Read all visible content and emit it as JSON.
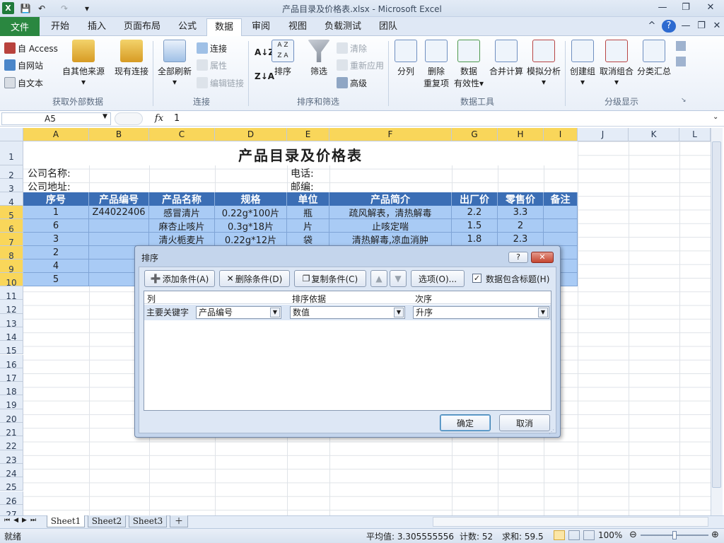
{
  "window": {
    "title": "产品目录及价格表.xlsx - Microsoft Excel",
    "app_letter": "X",
    "controls": {
      "minimize": "—",
      "restore": "❐",
      "close": "✕"
    },
    "ribbon_controls": {
      "collapse": "^",
      "help": "?",
      "minimize": "—",
      "restore": "❐",
      "close": "✕"
    }
  },
  "tabs": {
    "file": "文件",
    "items": [
      "开始",
      "插入",
      "页面布局",
      "公式",
      "数据",
      "审阅",
      "视图",
      "负载测试",
      "团队"
    ],
    "active": "数据"
  },
  "ribbon": {
    "get_external": {
      "label": "获取外部数据",
      "from_access": "自 Access",
      "from_web": "自网站",
      "from_text": "自文本",
      "from_other": "自其他来源",
      "existing": "现有连接"
    },
    "connections": {
      "label": "连接",
      "refresh_all": "全部刷新",
      "connections": "连接",
      "properties": "属性",
      "edit_links": "编辑链接"
    },
    "sort_filter": {
      "label": "排序和筛选",
      "sort": "排序",
      "filter": "筛选",
      "clear": "清除",
      "reapply": "重新应用",
      "advanced": "高级"
    },
    "data_tools": {
      "label": "数据工具",
      "text_to_columns": "分列",
      "remove_dup_1": "删除",
      "remove_dup_2": "重复项",
      "validation_1": "数据",
      "validation_2": "有效性",
      "consolidate": "合并计算",
      "what_if": "模拟分析"
    },
    "outline": {
      "label": "分级显示",
      "group": "创建组",
      "ungroup": "取消组合",
      "subtotal": "分类汇总"
    }
  },
  "formula_bar": {
    "name_box": "A5",
    "fx": "fx",
    "value": "1"
  },
  "columns": [
    "A",
    "B",
    "C",
    "D",
    "E",
    "F",
    "G",
    "H",
    "I",
    "J",
    "K",
    "L"
  ],
  "rows": [
    "1",
    "2",
    "3",
    "4",
    "5",
    "6",
    "7",
    "8",
    "9",
    "10",
    "11",
    "12",
    "13",
    "14",
    "15",
    "16",
    "17",
    "18",
    "19",
    "20",
    "21",
    "22",
    "23",
    "24",
    "25",
    "26",
    "27"
  ],
  "sheet": {
    "title": "产品目录及价格表",
    "company_name_label": "公司名称:",
    "company_addr_label": "公司地址:",
    "phone_label": "电话:",
    "postcode_label": "邮编:",
    "headers": [
      "序号",
      "产品编号",
      "产品名称",
      "规格",
      "单位",
      "产品简介",
      "出厂价",
      "零售价",
      "备注"
    ],
    "data_rows": [
      [
        "1",
        "Z44022406",
        "感冒清片",
        "0.22g*100片",
        "瓶",
        "疏风解表，清热解毒",
        "2.2",
        "3.3",
        ""
      ],
      [
        "6",
        "",
        "麻杏止咳片",
        "0.3g*18片",
        "片",
        "止咳定喘",
        "1.5",
        "2",
        ""
      ],
      [
        "3",
        "",
        "清火栀麦片",
        "0.22g*12片",
        "袋",
        "清热解毒,凉血消肿",
        "1.8",
        "2.3",
        ""
      ],
      [
        "2",
        "",
        "",
        "",
        "",
        "",
        "",
        "",
        ""
      ],
      [
        "4",
        "",
        "",
        "",
        "",
        "",
        "",
        "",
        ""
      ],
      [
        "5",
        "",
        "",
        "",
        "",
        "",
        "",
        "",
        ""
      ]
    ]
  },
  "sheet_tabs": [
    "Sheet1",
    "Sheet2",
    "Sheet3"
  ],
  "status": {
    "ready": "就绪",
    "average": "平均值: 3.305555556",
    "count": "计数: 52",
    "sum": "求和: 59.5",
    "zoom": "100%"
  },
  "sort_dialog": {
    "title": "排序",
    "add_level": "添加条件(A)",
    "delete_level": "删除条件(D)",
    "copy_level": "复制条件(C)",
    "options": "选项(O)...",
    "has_headers": "数据包含标题(H)",
    "has_headers_checked": true,
    "col_header_column": "列",
    "col_header_sorton": "排序依据",
    "col_header_order": "次序",
    "row_label": "主要关键字",
    "column_value": "产品编号",
    "sorton_value": "数值",
    "order_value": "升序",
    "ok": "确定",
    "cancel": "取消"
  }
}
